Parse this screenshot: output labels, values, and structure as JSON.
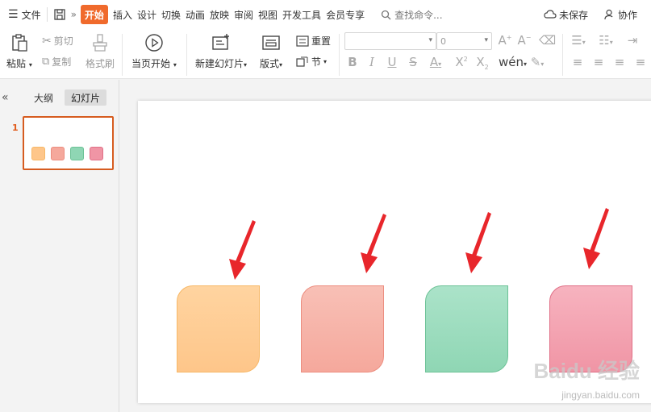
{
  "menu": {
    "file": "文件",
    "tabs": [
      "开始",
      "插入",
      "设计",
      "切换",
      "动画",
      "放映",
      "审阅",
      "视图",
      "开发工具",
      "会员专享"
    ],
    "active_tab": "开始",
    "search": "查找命令...",
    "unsaved": "未保存",
    "collab": "协作"
  },
  "ribbon": {
    "paste": "粘贴",
    "cut": "剪切",
    "copy": "复制",
    "format_painter": "格式刷",
    "play_from_start": "当页开始",
    "new_slide": "新建幻灯片",
    "layout": "版式",
    "reset": "重置",
    "section": "节",
    "font_size": "0"
  },
  "panel": {
    "tab_outline": "大纲",
    "tab_slides": "幻灯片",
    "slide_number": "1"
  },
  "slide": {
    "shape_colors": [
      "#fec68a",
      "#f5a89c",
      "#8fd6b4",
      "#f095a5"
    ],
    "arrow_color": "#e8262b"
  },
  "watermark": {
    "brand": "Baidu 经验",
    "url": "jingyan.baidu.com"
  }
}
